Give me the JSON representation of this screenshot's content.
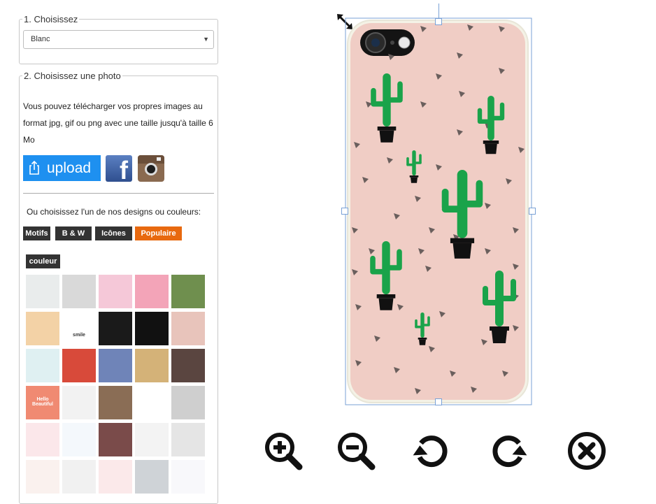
{
  "step1": {
    "legend": "1. Choisissez",
    "select_value": "Blanc"
  },
  "step2": {
    "legend": "2. Choisissez une photo",
    "description": "Vous pouvez télécharger vos propres images au format jpg, gif ou png avec une taille jusqu'à taille 6 Mo",
    "upload_label": "upload",
    "facebook_glyph": "f",
    "choose_text": "Ou choisissez l'un de nos designs ou couleurs:",
    "tabs": [
      {
        "label": "Motifs",
        "active": false
      },
      {
        "label": "B & W",
        "active": false
      },
      {
        "label": "Icônes",
        "active": false
      },
      {
        "label": "Populaire",
        "active": true
      },
      {
        "label": "couleur",
        "active": false
      }
    ],
    "thumbnails": [
      {
        "name": "marble",
        "color": "#e9ecec"
      },
      {
        "name": "polka-dots",
        "color": "#d9d9d9"
      },
      {
        "name": "zigzag-pastel",
        "color": "#f5c8d8"
      },
      {
        "name": "flamingos",
        "color": "#f3a4b8"
      },
      {
        "name": "tropical-leaves",
        "color": "#6f8f4e"
      },
      {
        "name": "hotdogs",
        "color": "#f3d2a6"
      },
      {
        "name": "camera-smile",
        "color": "#ffffff",
        "text": "smile"
      },
      {
        "name": "black-marble",
        "color": "#1a1a1a"
      },
      {
        "name": "black-wave",
        "color": "#111111"
      },
      {
        "name": "cactus",
        "color": "#e8c4bb"
      },
      {
        "name": "snowflakes",
        "color": "#dff0f2"
      },
      {
        "name": "rainbow-drip",
        "color": "#d84a3a"
      },
      {
        "name": "chevron-blue",
        "color": "#6f84b8"
      },
      {
        "name": "vintage-chart",
        "color": "#d4b278"
      },
      {
        "name": "clockwork",
        "color": "#5a4540"
      },
      {
        "name": "hello-beautiful",
        "color": "#f08a72",
        "text": "Hello Beautiful"
      },
      {
        "name": "doodle-swirls",
        "color": "#f2f2f2"
      },
      {
        "name": "wood-bird",
        "color": "#8a6d55"
      },
      {
        "name": "dreamcatcher",
        "color": "#ffffff"
      },
      {
        "name": "ink-splash",
        "color": "#cfcfcf"
      },
      {
        "name": "pastel-triangles",
        "color": "#fbe7ea"
      },
      {
        "name": "blue-feathers",
        "color": "#f4f8fc"
      },
      {
        "name": "roses-vintage",
        "color": "#7a4b4a"
      },
      {
        "name": "dots-black",
        "color": "#f3f3f3"
      },
      {
        "name": "grey-dashes",
        "color": "#e5e5e5"
      },
      {
        "name": "floral-white",
        "color": "#faf1ee"
      },
      {
        "name": "teal-triangles",
        "color": "#f1f1f1"
      },
      {
        "name": "watermelon",
        "color": "#fbe9ea"
      },
      {
        "name": "snowflakes-grey",
        "color": "#cfd3d7"
      },
      {
        "name": "confetti",
        "color": "#f8f8fb"
      }
    ]
  },
  "preview": {
    "design": "cactus",
    "case_color": "#f0cdc5",
    "cactus_color": "#1aa34a"
  },
  "toolbar": [
    {
      "name": "zoom-in-button",
      "icon": "zoom-in-icon"
    },
    {
      "name": "zoom-out-button",
      "icon": "zoom-out-icon"
    },
    {
      "name": "rotate-left-button",
      "icon": "rotate-left-icon"
    },
    {
      "name": "rotate-right-button",
      "icon": "rotate-right-icon"
    },
    {
      "name": "delete-button",
      "icon": "close-circle-icon"
    }
  ]
}
